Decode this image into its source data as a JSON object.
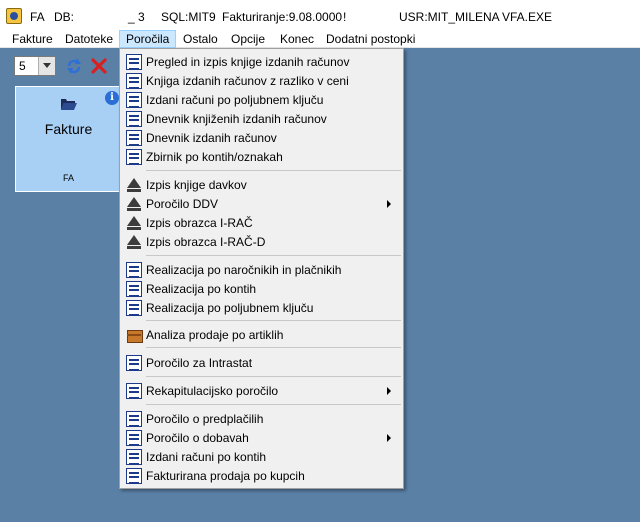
{
  "titlebar": {
    "app": "FA",
    "db_label": "DB:",
    "db_value": "_ 3",
    "sql": "SQL:MIT9",
    "fakturiranje": "Fakturiranje:9.08.0000",
    "marker": "!",
    "user": "USR:MIT_MILENA",
    "exe": "VFA.EXE"
  },
  "menubar": {
    "items": [
      "Fakture",
      "Datoteke",
      "Poročila",
      "Ostalo",
      "Opcije",
      "Konec",
      "Dodatni postopki"
    ],
    "active_index": 2
  },
  "toolbar": {
    "combo_value": "5"
  },
  "tile": {
    "title": "Fakture",
    "code": "FA",
    "info_symbol": "i"
  },
  "dropdown": {
    "items": [
      {
        "label": "Pregled in izpis knjige izdanih računov",
        "icon": "list-icon",
        "submenu": false
      },
      {
        "label": "Knjiga izdanih računov z razliko v ceni",
        "icon": "list-icon",
        "submenu": false
      },
      {
        "label": "Izdani računi po poljubnem ključu",
        "icon": "list-icon",
        "submenu": false
      },
      {
        "label": "Dnevnik knjiženih izdanih računov",
        "icon": "list-icon",
        "submenu": false
      },
      {
        "label": "Dnevnik izdanih računov",
        "icon": "list-icon",
        "submenu": false
      },
      {
        "label": "Zbirnik po kontih/oznakah",
        "icon": "list-icon",
        "submenu": false
      },
      {
        "label": "Izpis knjige davkov",
        "icon": "furs-icon",
        "submenu": false
      },
      {
        "label": "Poročilo DDV",
        "icon": "furs-icon",
        "submenu": true
      },
      {
        "label": "Izpis obrazca I-RAČ",
        "icon": "furs-icon",
        "submenu": false
      },
      {
        "label": "Izpis obrazca I-RAČ-D",
        "icon": "furs-icon",
        "submenu": false
      },
      {
        "label": "Realizacija po naročnikih in plačnikih",
        "icon": "list-icon",
        "submenu": false
      },
      {
        "label": "Realizacija po kontih",
        "icon": "list-icon",
        "submenu": false
      },
      {
        "label": "Realizacija po poljubnem ključu",
        "icon": "list-icon",
        "submenu": false
      },
      {
        "label": "Analiza prodaje po artiklih",
        "icon": "box-icon",
        "submenu": false
      },
      {
        "label": "Poročilo za Intrastat",
        "icon": "list-icon",
        "submenu": false
      },
      {
        "label": "Rekapitulacijsko poročilo",
        "icon": "list-icon",
        "submenu": true
      },
      {
        "label": "Poročilo o predplačilih",
        "icon": "list-icon",
        "submenu": false
      },
      {
        "label": "Poročilo o dobavah",
        "icon": "list-icon",
        "submenu": true
      },
      {
        "label": "Izdani računi po kontih",
        "icon": "list-icon",
        "submenu": false
      },
      {
        "label": "Fakturirana prodaja po kupcih",
        "icon": "list-icon",
        "submenu": false
      }
    ]
  },
  "colors": {
    "desktop": "#5a80a6",
    "tile": "#a8d0f5",
    "menu_highlight": "#cce8ff"
  }
}
